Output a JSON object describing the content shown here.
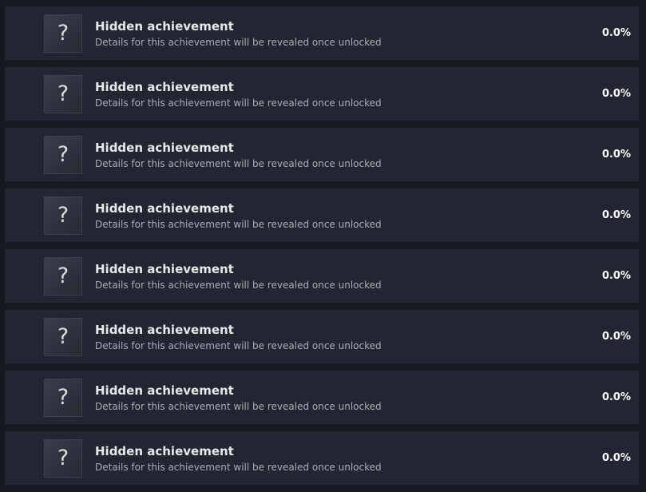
{
  "achievements": [
    {
      "title": "Hidden achievement",
      "description": "Details for this achievement will be revealed once unlocked",
      "percent": "0.0%",
      "icon": "question-mark-icon"
    },
    {
      "title": "Hidden achievement",
      "description": "Details for this achievement will be revealed once unlocked",
      "percent": "0.0%",
      "icon": "question-mark-icon"
    },
    {
      "title": "Hidden achievement",
      "description": "Details for this achievement will be revealed once unlocked",
      "percent": "0.0%",
      "icon": "question-mark-icon"
    },
    {
      "title": "Hidden achievement",
      "description": "Details for this achievement will be revealed once unlocked",
      "percent": "0.0%",
      "icon": "question-mark-icon"
    },
    {
      "title": "Hidden achievement",
      "description": "Details for this achievement will be revealed once unlocked",
      "percent": "0.0%",
      "icon": "question-mark-icon"
    },
    {
      "title": "Hidden achievement",
      "description": "Details for this achievement will be revealed once unlocked",
      "percent": "0.0%",
      "icon": "question-mark-icon"
    },
    {
      "title": "Hidden achievement",
      "description": "Details for this achievement will be revealed once unlocked",
      "percent": "0.0%",
      "icon": "question-mark-icon"
    },
    {
      "title": "Hidden achievement",
      "description": "Details for this achievement will be revealed once unlocked",
      "percent": "0.0%",
      "icon": "question-mark-icon"
    }
  ],
  "icon_glyph": "?",
  "colors": {
    "background": "#151920",
    "row": "#232630",
    "title": "#e6e8ea",
    "description": "#a7adb5",
    "percent": "#ffffff"
  }
}
